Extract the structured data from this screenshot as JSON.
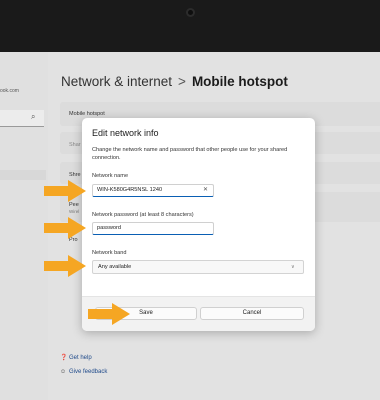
{
  "settings": {
    "account_email": "ook.com",
    "breadcrumb_parent": "Network & internet",
    "breadcrumb_separator": ">",
    "breadcrumb_current": "Mobile hotspot",
    "mobile_hotspot_label": "Mobile hotspot",
    "row_share": "Shar",
    "row_share_from": "Shre",
    "row_properties_1": "Pee",
    "row_properties_2": "Wirel",
    "row_properties_3": "Pro",
    "get_help": "Get help",
    "give_feedback": "Give feedback"
  },
  "dialog": {
    "title": "Edit network info",
    "description": "Change the network name and password that other people use for your shared connection.",
    "network_name_label": "Network name",
    "network_name_value": "WIN-K580G4R5NSL 1240",
    "network_password_label": "Network password (at least 8 characters)",
    "network_password_value": "password",
    "network_band_label": "Network band",
    "network_band_value": "Any available",
    "save_label": "Save",
    "cancel_label": "Cancel"
  },
  "colors": {
    "arrow": "#f5a623",
    "accent": "#0a5fb4",
    "link": "#1f4a8a"
  },
  "icons": {
    "search": "search-icon",
    "clear": "clear-icon",
    "chevron": "chevron-down-icon",
    "help": "help-icon",
    "feedback": "feedback-icon"
  }
}
